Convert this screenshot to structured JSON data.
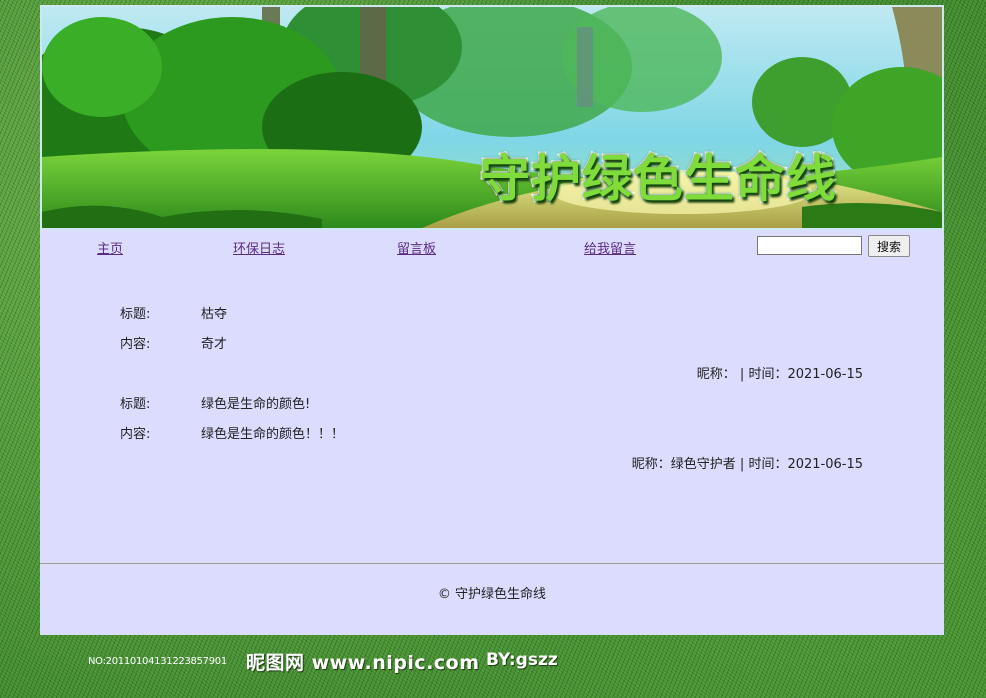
{
  "banner": {
    "title": "守护绿色生命线"
  },
  "nav": {
    "items": [
      {
        "label": "主页"
      },
      {
        "label": "环保日志"
      },
      {
        "label": "留言板"
      },
      {
        "label": "给我留言"
      }
    ],
    "search": {
      "value": "",
      "button_label": "搜索"
    }
  },
  "messages": [
    {
      "title_label": "标题:",
      "title": "枯夺",
      "content_label": "内容:",
      "content": "奇才",
      "meta": "昵称：  | 时间：2021-06-15"
    },
    {
      "title_label": "标题:",
      "title": "绿色是生命的颜色!",
      "content_label": "内容:",
      "content": "绿色是生命的颜色！！！",
      "meta": "昵称：绿色守护者 | 时间：2021-06-15"
    }
  ],
  "footer": {
    "text": "© 守护绿色生命线"
  },
  "watermark": {
    "id_text": "NO:20110104131223857901",
    "site_text": "昵图网 www.nipic.com",
    "by_text": "BY:gszz"
  }
}
